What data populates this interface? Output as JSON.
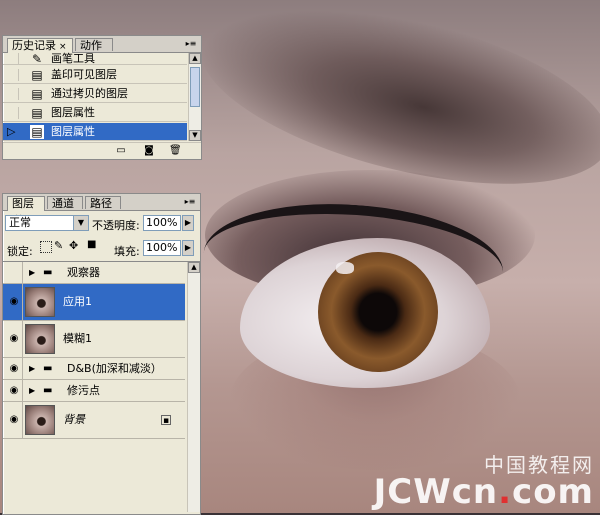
{
  "history_panel": {
    "tabs": [
      {
        "label": "历史记录",
        "close": "×"
      },
      {
        "label": "动作"
      }
    ],
    "menu_icon": "▸≡",
    "items": [
      {
        "label": "画笔工具",
        "icon": "brush-icon"
      },
      {
        "label": "盖印可见图层",
        "icon": "document-icon"
      },
      {
        "label": "通过拷贝的图层",
        "icon": "document-icon"
      },
      {
        "label": "图层属性",
        "icon": "document-icon"
      },
      {
        "label": "图层属性",
        "icon": "document-icon",
        "selected": true
      }
    ],
    "footer_icons": [
      "new-document-icon",
      "camera-icon",
      "trash-icon"
    ]
  },
  "layers_panel": {
    "tabs": [
      {
        "label": "图层",
        "close": "×"
      },
      {
        "label": "通道"
      },
      {
        "label": "路径"
      }
    ],
    "blend_mode": "正常",
    "opacity_label": "不透明度:",
    "opacity_value": "100%",
    "lock_label": "锁定:",
    "fill_label": "填充:",
    "fill_value": "100%",
    "layers": [
      {
        "name": "观察器",
        "type": "group",
        "visible": false
      },
      {
        "name": "应用1",
        "type": "layer",
        "visible": true,
        "selected": true
      },
      {
        "name": "模糊1",
        "type": "layer",
        "visible": true
      },
      {
        "name": "D&B(加深和减淡）",
        "type": "group",
        "visible": true
      },
      {
        "name": "修污点",
        "type": "group",
        "visible": true
      },
      {
        "name": "背景",
        "type": "layer",
        "visible": true,
        "locked": true
      }
    ]
  },
  "watermark": {
    "line1": "中国教程网",
    "line2_part1": "JCWcn",
    "line2_dot": ".",
    "line2_part2": "com"
  },
  "colors": {
    "selection": "#316ac5",
    "panel_bg": "#ece9d8",
    "watermark_red": "#e03030"
  }
}
